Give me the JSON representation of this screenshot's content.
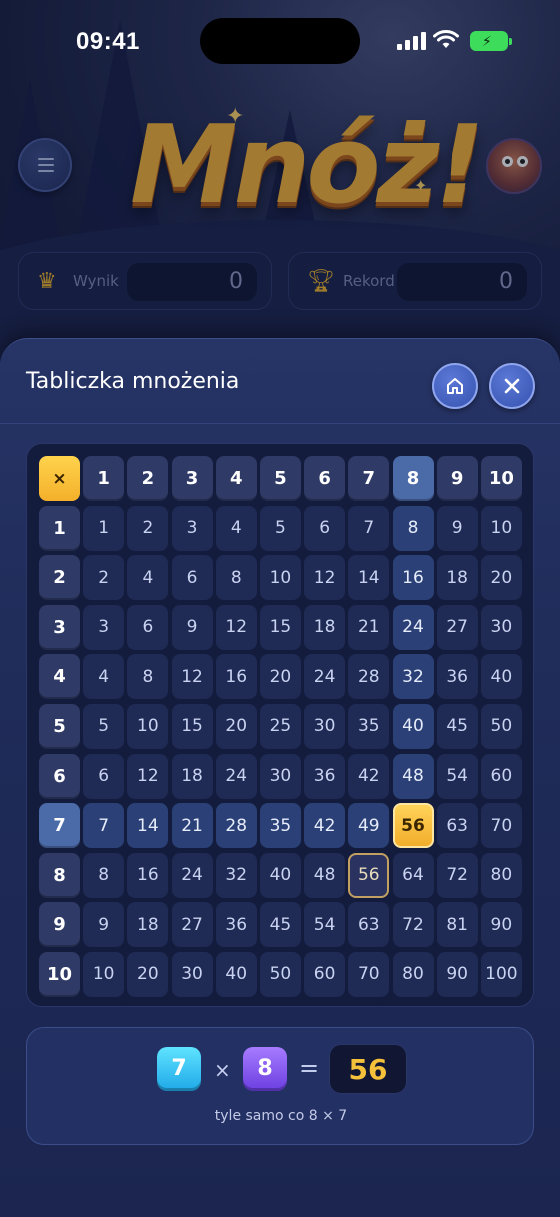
{
  "status_bar": {
    "time": "09:41"
  },
  "header": {
    "logo_text": "Mnóż!"
  },
  "scores": [
    {
      "label": "Wynik",
      "value": "0",
      "icon": "crown-icon"
    },
    {
      "label": "Rekord",
      "value": "0",
      "icon": "trophy-icon"
    }
  ],
  "sheet": {
    "title": "Tabliczka mnożenia",
    "corner_symbol": "×"
  },
  "table": {
    "headers": [
      "1",
      "2",
      "3",
      "4",
      "5",
      "6",
      "7",
      "8",
      "9",
      "10"
    ],
    "highlight_row": 7,
    "highlight_col": 8,
    "answer_cell": {
      "row": 7,
      "col": 8
    },
    "mirror_cell": {
      "row": 8,
      "col": 7
    }
  },
  "equation": {
    "a": "7",
    "times": "×",
    "b": "8",
    "equals": "=",
    "result": "56",
    "hint": "tyle samo co 8 × 7"
  },
  "colors": {
    "accent": "#f4b02a",
    "tile_a": "#1fa8e8",
    "tile_b": "#6b3ee0"
  }
}
